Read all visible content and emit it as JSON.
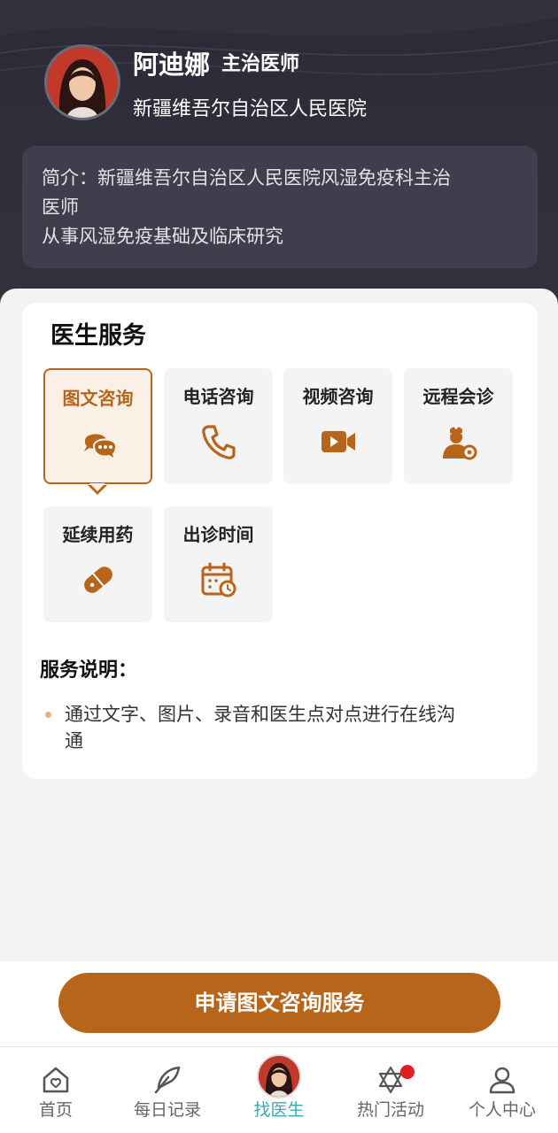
{
  "doctor": {
    "name": "阿迪娜",
    "title": "主治医师",
    "hospital": "新疆维吾尔自治区人民医院",
    "intro_line1": "简介：新疆维吾尔自治区人民医院风湿免疫科主治",
    "intro_line2": "医师",
    "intro_line3": "从事风湿免疫基础及临床研究"
  },
  "services": {
    "title": "医生服务",
    "items": [
      {
        "label": "图文咨询",
        "icon": "chat-bubbles-icon",
        "active": true
      },
      {
        "label": "电话咨询",
        "icon": "phone-icon"
      },
      {
        "label": "视频咨询",
        "icon": "video-camera-icon"
      },
      {
        "label": "远程会诊",
        "icon": "remote-consult-icon"
      },
      {
        "label": "延续用药",
        "icon": "pill-icon"
      },
      {
        "label": "出诊时间",
        "icon": "calendar-clock-icon"
      }
    ],
    "desc_heading": "服务说明：",
    "desc_line1": "通过文字、图片、录音和医生点对点进行在线沟",
    "desc_line2": "通"
  },
  "apply_button": "申请图文咨询服务",
  "tabbar": {
    "items": [
      {
        "label": "首页",
        "icon": "home-icon"
      },
      {
        "label": "每日记录",
        "icon": "feather-icon"
      },
      {
        "label": "找医生",
        "icon": "doctor-avatar",
        "active": true
      },
      {
        "label": "热门活动",
        "icon": "star-of-david-icon",
        "badge": true
      },
      {
        "label": "个人中心",
        "icon": "person-icon"
      }
    ]
  },
  "colors": {
    "accent": "#b8651c",
    "header_bg": "#2b2a36",
    "active_tab": "#3aa9b8",
    "badge": "#e02020"
  }
}
